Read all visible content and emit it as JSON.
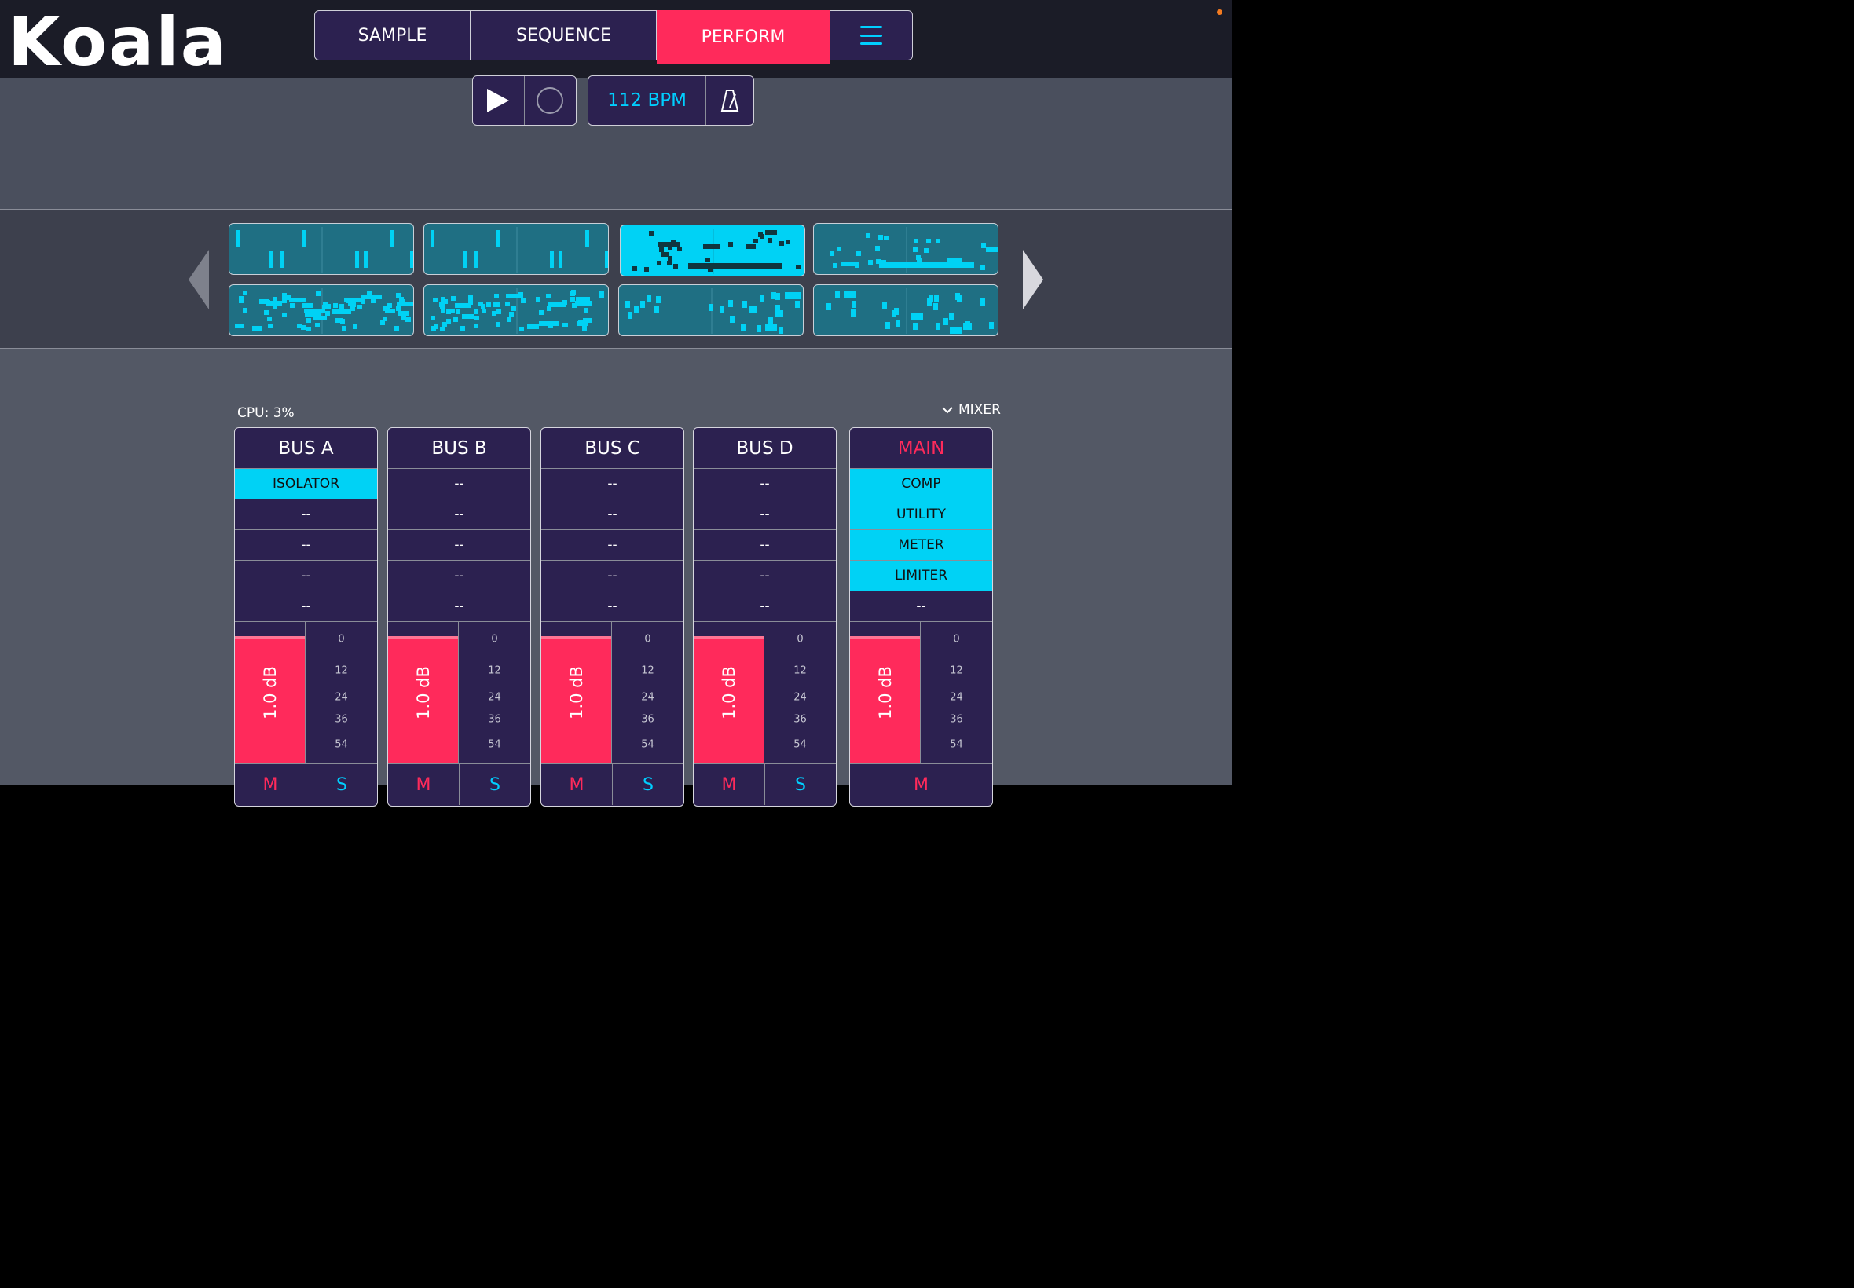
{
  "app": {
    "logo": "Koala"
  },
  "colors": {
    "accent_pink": "#ff2a5b",
    "accent_cyan": "#00d2f5",
    "panel": "#2c2150",
    "status_dot": "#f47b20"
  },
  "tabs": [
    {
      "label": "SAMPLE",
      "active": false
    },
    {
      "label": "SEQUENCE",
      "active": false
    },
    {
      "label": "PERFORM",
      "active": true
    }
  ],
  "menu": {
    "icon": "hamburger-menu-icon"
  },
  "transport": {
    "play_icon": "play-icon",
    "record_icon": "record-icon",
    "bpm_label": "112 BPM",
    "metronome_icon": "metronome-icon"
  },
  "patterns": {
    "prev_icon": "chevron-left-icon",
    "next_icon": "chevron-right-icon",
    "active_index": 2,
    "count": 8
  },
  "mixer": {
    "cpu_label": "CPU: 3%",
    "toggle_label": "MIXER",
    "toggle_icon": "chevron-down-icon",
    "scale_ticks": [
      "0",
      "12",
      "24",
      "36",
      "54"
    ],
    "channels": [
      {
        "name": "BUS A",
        "is_main": false,
        "slots": [
          "ISOLATOR",
          "--",
          "--",
          "--",
          "--"
        ],
        "active_slots": [
          0
        ],
        "gain_label": "1.0 dB",
        "level": 0.9,
        "mute": "M",
        "solo": "S"
      },
      {
        "name": "BUS B",
        "is_main": false,
        "slots": [
          "--",
          "--",
          "--",
          "--",
          "--"
        ],
        "active_slots": [],
        "gain_label": "1.0 dB",
        "level": 0.9,
        "mute": "M",
        "solo": "S"
      },
      {
        "name": "BUS C",
        "is_main": false,
        "slots": [
          "--",
          "--",
          "--",
          "--",
          "--"
        ],
        "active_slots": [],
        "gain_label": "1.0 dB",
        "level": 0.9,
        "mute": "M",
        "solo": "S"
      },
      {
        "name": "BUS D",
        "is_main": false,
        "slots": [
          "--",
          "--",
          "--",
          "--",
          "--"
        ],
        "active_slots": [],
        "gain_label": "1.0 dB",
        "level": 0.9,
        "mute": "M",
        "solo": "S"
      },
      {
        "name": "MAIN",
        "is_main": true,
        "slots": [
          "COMP",
          "UTILITY",
          "METER",
          "LIMITER",
          "--"
        ],
        "active_slots": [
          0,
          1,
          2,
          3
        ],
        "gain_label": "1.0 dB",
        "level": 0.9,
        "mute": "M",
        "solo": null
      }
    ]
  }
}
